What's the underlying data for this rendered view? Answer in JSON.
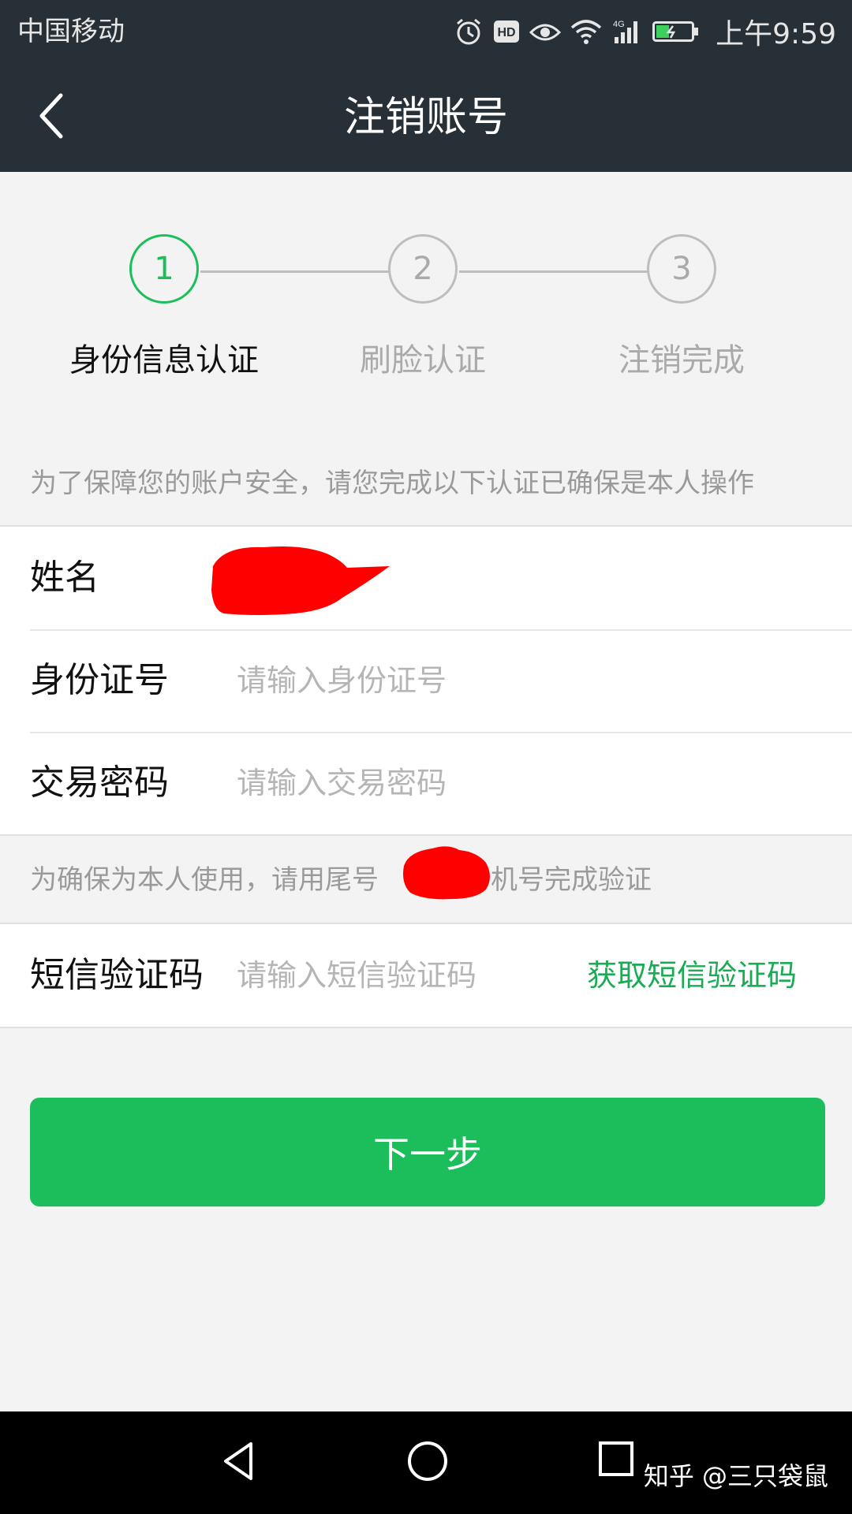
{
  "status_bar": {
    "carrier": "中国移动",
    "network": "4G",
    "time": "上午9:59",
    "icons": [
      "alarm-icon",
      "hd-icon",
      "eye-icon",
      "wifi-icon",
      "signal-icon",
      "battery-icon"
    ]
  },
  "title_bar": {
    "back_icon": "chevron-left-icon",
    "title": "注销账号"
  },
  "steps": [
    {
      "number": "1",
      "label": "身份信息认证",
      "active": true
    },
    {
      "number": "2",
      "label": "刷脸认证",
      "active": false
    },
    {
      "number": "3",
      "label": "注销完成",
      "active": false
    }
  ],
  "notice": "为了保障您的账户安全，请您完成以下认证已确保是本人操作",
  "form": {
    "name_label": "姓名",
    "id_label": "身份证号",
    "id_placeholder": "请输入身份证号",
    "password_label": "交易密码",
    "password_placeholder": "请输入交易密码"
  },
  "verify_notice": {
    "prefix": "为确保为本人使用，请用尾号",
    "suffix": "的手机号完成验证"
  },
  "sms": {
    "label": "短信验证码",
    "placeholder": "请输入短信验证码",
    "get_code": "获取短信验证码"
  },
  "next_button": "下一步",
  "nav_bar": {
    "icons": [
      "nav-back-icon",
      "nav-home-icon",
      "nav-recents-icon"
    ]
  },
  "watermark": "知乎 @三只袋鼠",
  "colors": {
    "header_bg": "#273037",
    "accent_green": "#1bbe5a",
    "page_bg": "#f3f3f3",
    "redaction": "#ff0000"
  }
}
